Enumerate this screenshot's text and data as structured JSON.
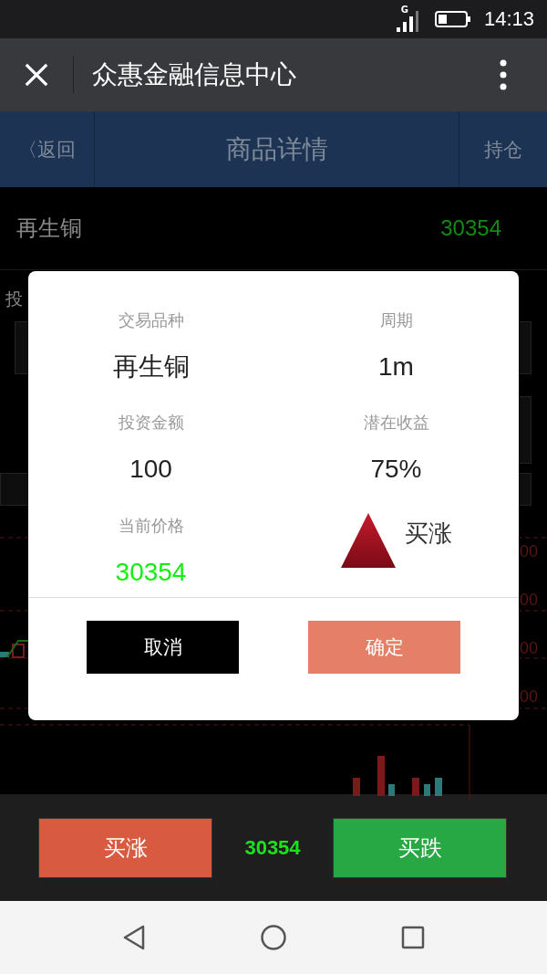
{
  "status_bar": {
    "network": "G",
    "time": "14:13"
  },
  "app_bar": {
    "title": "众惠金融信息中心"
  },
  "header": {
    "back": "〈返回",
    "title": "商品详情",
    "right": "持仓"
  },
  "product": {
    "name": "再生铜",
    "price": "30354"
  },
  "background": {
    "cut_label": "投",
    "axis_labels": [
      "00",
      "00",
      "00",
      "00"
    ]
  },
  "dialog": {
    "fields": [
      {
        "label": "交易品种",
        "value": "再生铜",
        "kind": "text"
      },
      {
        "label": "周期",
        "value": "1m",
        "kind": "text"
      },
      {
        "label": "投资金额",
        "value": "100",
        "kind": "text"
      },
      {
        "label": "潜在收益",
        "value": "75%",
        "kind": "text"
      },
      {
        "label": "当前价格",
        "value": "30354",
        "kind": "price"
      },
      {
        "value": "买涨",
        "kind": "up"
      }
    ],
    "buttons": [
      {
        "label": "取消",
        "kind": "cancel"
      },
      {
        "label": "确定",
        "kind": "confirm"
      }
    ]
  },
  "bottom_bar": {
    "buy_up": "买涨",
    "price": "30354",
    "buy_down": "买跌"
  }
}
